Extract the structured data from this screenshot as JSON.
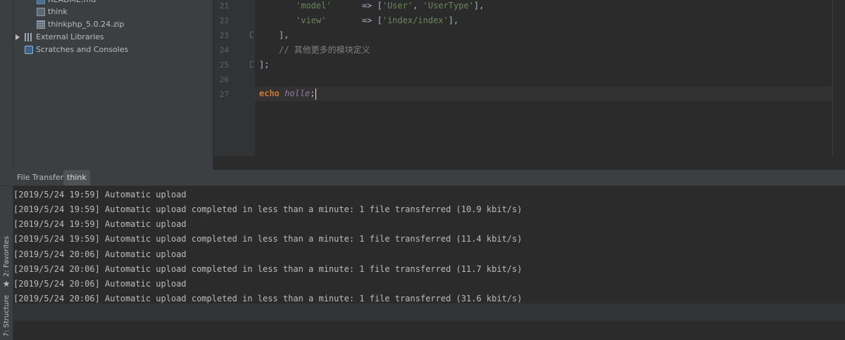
{
  "tool_windows": {
    "favorites_label": "2: Favorites",
    "structure_label": "7: Structure"
  },
  "project_tree": {
    "items": [
      {
        "label": "README.md",
        "icon": "markdown-file-icon"
      },
      {
        "label": "think",
        "icon": "file-icon"
      },
      {
        "label": "thinkphp_5.0.24.zip",
        "icon": "zip-file-icon"
      },
      {
        "label": "External Libraries",
        "icon": "library-icon"
      },
      {
        "label": "Scratches and Consoles",
        "icon": "scratches-icon"
      }
    ]
  },
  "editor": {
    "line_numbers": [
      "21",
      "22",
      "23",
      "24",
      "25",
      "26",
      "27"
    ],
    "lines": {
      "l21": {
        "key": "'model'",
        "arrow": "=> [",
        "v1": "'User'",
        "comma": ", ",
        "v2": "'UserType'",
        "end": "],"
      },
      "l22": {
        "key": "'view'",
        "arrow": "=> [",
        "v1": "'index/index'",
        "end": "],"
      },
      "l23": "],",
      "l24": "// 其他更多的模块定义",
      "l25": "];",
      "l27": {
        "keyword": "echo",
        "constant": "holle",
        "semicolon": ";"
      }
    }
  },
  "bottom_panel": {
    "tabs": [
      "File Transfer",
      "think"
    ],
    "active_tab": "think",
    "log": [
      "[2019/5/24 19:59] Automatic upload",
      "[2019/5/24 19:59] Automatic upload completed in less than a minute: 1 file transferred (10.9 kbit/s)",
      "[2019/5/24 19:59] Automatic upload",
      "[2019/5/24 19:59] Automatic upload completed in less than a minute: 1 file transferred (11.4 kbit/s)",
      "[2019/5/24 20:06] Automatic upload",
      "[2019/5/24 20:06] Automatic upload completed in less than a minute: 1 file transferred (11.7 kbit/s)",
      "[2019/5/24 20:06] Automatic upload",
      "[2019/5/24 20:06] Automatic upload completed in less than a minute: 1 file transferred (31.6 kbit/s)"
    ]
  },
  "colors": {
    "background": "#2b2b2b",
    "panel": "#3c3f41",
    "string": "#6a8759",
    "keyword": "#cc7832",
    "constant": "#9876aa",
    "comment": "#808080"
  }
}
